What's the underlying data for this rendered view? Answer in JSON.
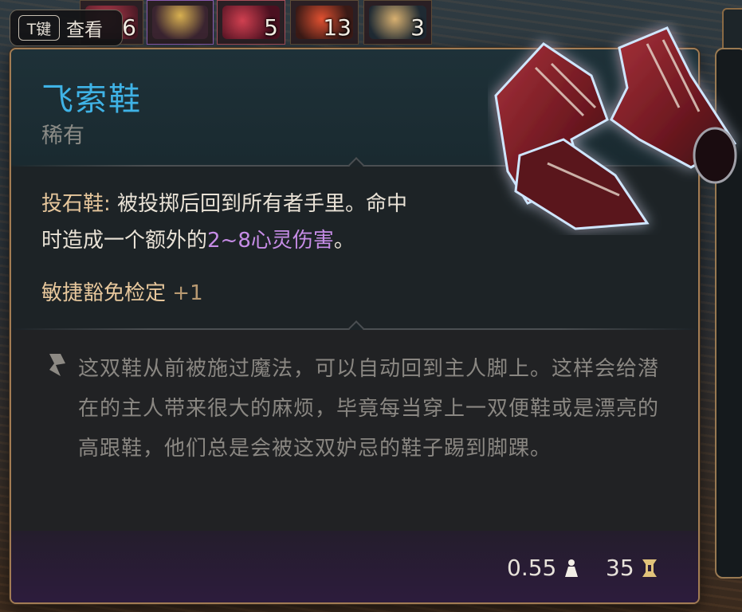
{
  "hint": {
    "key": "T键",
    "label": "查看"
  },
  "inventory": [
    {
      "count": "6",
      "icon": "potion-icon"
    },
    {
      "count": "",
      "icon": "amulet-icon"
    },
    {
      "count": "5",
      "icon": "horn-icon"
    },
    {
      "count": "13",
      "icon": "orb-icon"
    },
    {
      "count": "3",
      "icon": "vial-icon"
    }
  ],
  "item": {
    "name": "飞索鞋",
    "rarity": "稀有",
    "property": {
      "name": "投石鞋:",
      "text_part1": " 被投掷后回到所有者手里。命中",
      "text_part2": "时造成一个额外的",
      "damage": "2~8心灵伤害",
      "text_end": "。"
    },
    "bonus": {
      "label": "敏捷豁免检定",
      "value": "+1"
    },
    "lore": "这双鞋从前被施过魔法，可以自动回到主人脚上。这样会给潜在的主人带来很大的麻烦，毕竟每当穿上一双便鞋或是漂亮的高跟鞋，他们总是会被这双妒忌的鞋子踢到脚踝。",
    "weight": "0.55",
    "value": "35"
  },
  "colors": {
    "title": "#3fb3e6",
    "damage": "#c68ce6",
    "border": "#a27c54"
  }
}
